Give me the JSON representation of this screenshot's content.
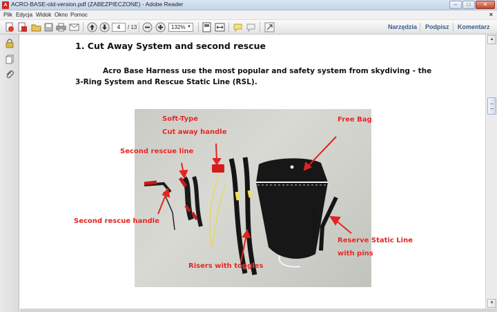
{
  "window": {
    "title": "ACRO-BASE-old-version.pdf (ZABEZPIECZONE) - Adobe Reader",
    "buttons": {
      "minimize": "–",
      "maximize": "□",
      "close": "✕"
    }
  },
  "menu": {
    "items": [
      "Plik",
      "Edycja",
      "Widok",
      "Okno",
      "Pomoc"
    ],
    "close_glyph": "×"
  },
  "toolbar": {
    "page_current": "4",
    "page_total": "/ 13",
    "zoom": "132%",
    "links": [
      "Narzędzia",
      "Podpisz",
      "Komentarz"
    ]
  },
  "document": {
    "heading": "1. Cut Away System and second rescue",
    "paragraph": "Acro Base Harness use the most popular and safety system from skydiving - the 3-Ring System and  Rescue Static Line (RSL).",
    "photo_labels": {
      "soft_type": "Soft-Type",
      "cut_away_handle": "Cut away handle",
      "free_bag": "Free Bag",
      "second_rescue_line": "Second rescue line",
      "second_rescue_handle": "Second rescue handle",
      "reserve_static_line": "Reserve Static Line",
      "with_pins": "with pins",
      "risers_with_toggles": "Risers with toggles"
    }
  },
  "colors": {
    "label_red": "#e2241f",
    "link_blue": "#3c5d8c",
    "title_bar": "#c4d5ea"
  }
}
